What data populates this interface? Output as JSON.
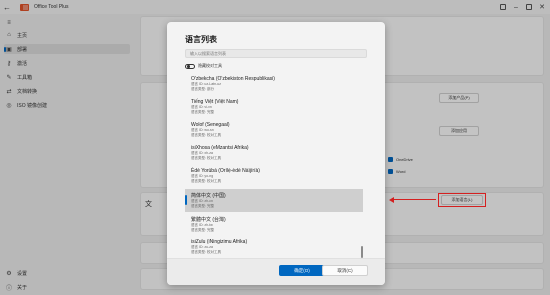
{
  "app": {
    "title": "Office Tool Plus"
  },
  "sidebar": {
    "items": [
      {
        "label": "主页",
        "icon": "home-icon"
      },
      {
        "label": "部署",
        "icon": "deploy-icon"
      },
      {
        "label": "激活",
        "icon": "key-icon"
      },
      {
        "label": "工具箱",
        "icon": "toolbox-icon"
      },
      {
        "label": "文档转换",
        "icon": "convert-icon"
      },
      {
        "label": "ISO 镜像创建",
        "icon": "disc-icon"
      }
    ],
    "bottom": [
      {
        "label": "设置",
        "icon": "gear-icon"
      },
      {
        "label": "关于",
        "icon": "info-icon"
      }
    ]
  },
  "background": {
    "add_product_button": "添加产品(P)",
    "add_app_button": "添加应用",
    "add_language_button": "添加语言(L)",
    "onedrive_label": "OneDrive",
    "word_label": "Word",
    "partial_labels": [
      "产品",
      "语言",
      "安装",
      "预览"
    ]
  },
  "dialog": {
    "title": "语言列表",
    "search_placeholder": "输入以搜索语言列表",
    "toggle_label": "隐藏校对工具",
    "languages": [
      {
        "name": "O'zbekcha (O'zbekiston Respublikasi)",
        "id": "语言 ID: uz-Latn-uz",
        "type": "语言类型: 部分"
      },
      {
        "name": "Tiếng Việt (Việt Nam)",
        "id": "语言 ID: vi-vn",
        "type": "语言类型: 完整"
      },
      {
        "name": "Wolof (Senegaal)",
        "id": "语言 ID: wo-sn",
        "type": "语言类型: 校对工具"
      },
      {
        "name": "isiXhosa (eMzantsi Afrika)",
        "id": "语言 ID: xh-za",
        "type": "语言类型: 校对工具"
      },
      {
        "name": "Èdè Yorùbá (Orílẹ̀-èdè Nàìjíríà)",
        "id": "语言 ID: yo-ng",
        "type": "语言类型: 校对工具"
      },
      {
        "name": "简体中文 (中国)",
        "id": "语言 ID: zh-cn",
        "type": "语言类型: 完整",
        "selected": true
      },
      {
        "name": "繁體中文 (台灣)",
        "id": "语言 ID: zh-tw",
        "type": "语言类型: 完整"
      },
      {
        "name": "isiZulu (iNingizimu Afrika)",
        "id": "语言 ID: zu-za",
        "type": "语言类型: 校对工具"
      }
    ],
    "ok_button": "确定(O)",
    "cancel_button": "取消(C)"
  },
  "colors": {
    "accent": "#0067c0",
    "annotation": "#d42020"
  }
}
